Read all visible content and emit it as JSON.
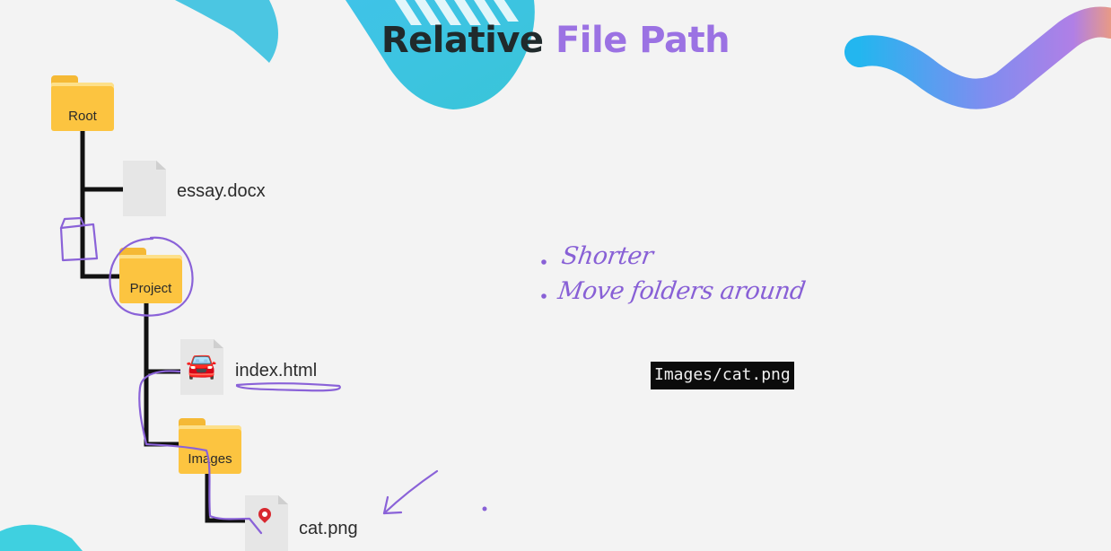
{
  "slide": {
    "title_part1": "Relative",
    "title_part2": "File Path",
    "accent_color": "#9b72e3",
    "annotation_color": "#8860d6"
  },
  "tree": {
    "root_label": "Root",
    "essay_label": "essay.docx",
    "project_label": "Project",
    "index_label": "index.html",
    "images_label": "Images",
    "cat_label": "cat.png"
  },
  "code_snippet": "Images/cat.png",
  "notes": [
    "Shorter",
    "Move folders around"
  ],
  "icons": [
    "folder-icon",
    "document-icon",
    "car-icon",
    "map-pin-icon"
  ]
}
